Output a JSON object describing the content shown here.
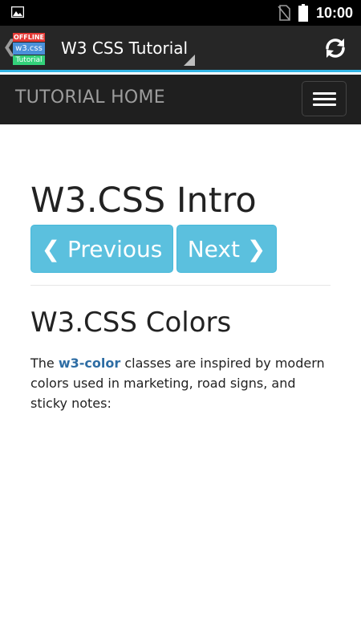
{
  "status_bar": {
    "time": "10:00",
    "icons": [
      "image-notification-icon",
      "no-sim-icon",
      "battery-icon"
    ]
  },
  "app_bar": {
    "back_glyph": "❮",
    "logo": {
      "offline": "OFFLINE",
      "w3css": "w3.css",
      "tutorial": "Tutorial"
    },
    "title": "W3 CSS Tutorial",
    "accent_color": "#33b5e5",
    "refresh_icon": "refresh-icon"
  },
  "nav_bar": {
    "home_label": "TUTORIAL HOME",
    "menu_icon": "hamburger-menu-icon"
  },
  "content": {
    "intro_title": "W3.CSS Intro",
    "prev_label": "❮ Previous",
    "next_label": "Next ❯",
    "section_title": "W3.CSS Colors",
    "text_before": "The ",
    "text_link": "w3-color",
    "text_after": " classes are inspired by modern colors used in marketing, road signs, and sticky notes:",
    "button_color": "#5bc0de"
  }
}
